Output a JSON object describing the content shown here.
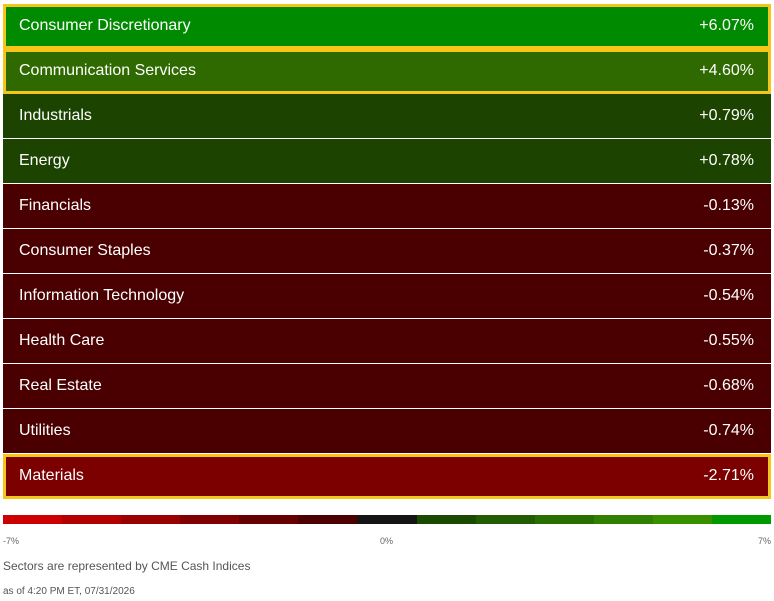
{
  "sectors": [
    {
      "name": "Consumer Discretionary",
      "change": "+6.07%",
      "color": "#008a00",
      "highlighted": true
    },
    {
      "name": "Communication Services",
      "change": "+4.60%",
      "color": "#2e6a00",
      "highlighted": true
    },
    {
      "name": "Industrials",
      "change": "+0.79%",
      "color": "#1c4300",
      "highlighted": false
    },
    {
      "name": "Energy",
      "change": "+0.78%",
      "color": "#1c4300",
      "highlighted": false
    },
    {
      "name": "Financials",
      "change": "-0.13%",
      "color": "#4a0000",
      "highlighted": false
    },
    {
      "name": "Consumer Staples",
      "change": "-0.37%",
      "color": "#4a0000",
      "highlighted": false
    },
    {
      "name": "Information Technology",
      "change": "-0.54%",
      "color": "#4a0000",
      "highlighted": false
    },
    {
      "name": "Health Care",
      "change": "-0.55%",
      "color": "#4a0000",
      "highlighted": false
    },
    {
      "name": "Real Estate",
      "change": "-0.68%",
      "color": "#4a0000",
      "highlighted": false
    },
    {
      "name": "Utilities",
      "change": "-0.74%",
      "color": "#4a0000",
      "highlighted": false
    },
    {
      "name": "Materials",
      "change": "-2.71%",
      "color": "#7c0000",
      "highlighted": true
    }
  ],
  "scale": {
    "min_label": "-7%",
    "mid_label": "0%",
    "max_label": "7%",
    "colors": [
      "#cc0000",
      "#b20000",
      "#990000",
      "#800000",
      "#660000",
      "#4d0000",
      "#141414",
      "#1a4a00",
      "#215c00",
      "#286e00",
      "#307f00",
      "#389000",
      "#009a00"
    ]
  },
  "footer": {
    "source_note": "Sectors are represented by CME Cash Indices",
    "timestamp": "as of 4:20 PM ET, 07/31/2026"
  }
}
